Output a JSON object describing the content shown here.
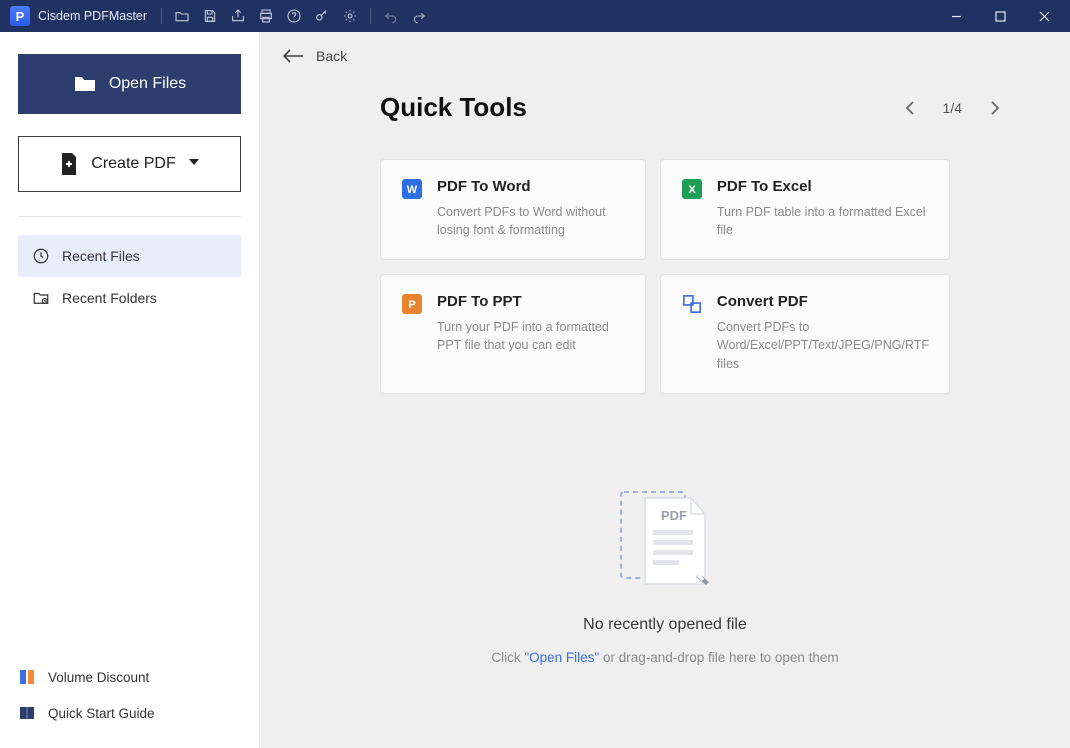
{
  "titlebar": {
    "app_name": "Cisdem PDFMaster"
  },
  "sidebar": {
    "open_files": "Open Files",
    "create_pdf": "Create PDF",
    "recent_files": "Recent Files",
    "recent_folders": "Recent Folders",
    "volume_discount": "Volume Discount",
    "quick_start_guide": "Quick Start Guide"
  },
  "content": {
    "back": "Back",
    "title": "Quick Tools",
    "page_indicator": "1/4",
    "cards": [
      {
        "title": "PDF To Word",
        "desc": "Convert PDFs to Word without losing font & formatting"
      },
      {
        "title": "PDF To Excel",
        "desc": "Turn PDF table into a formatted Excel file"
      },
      {
        "title": "PDF To PPT",
        "desc": "Turn your PDF into a formatted PPT file that you can edit"
      },
      {
        "title": "Convert PDF",
        "desc": "Convert PDFs to Word/Excel/PPT/Text/JPEG/PNG/RTF files"
      }
    ],
    "empty_heading": "No recently opened file",
    "empty_hint_pre": "Click ",
    "empty_hint_link": "\"Open Files\"",
    "empty_hint_post": " or drag-and-drop file here to open them",
    "pdf_badge": "PDF"
  }
}
